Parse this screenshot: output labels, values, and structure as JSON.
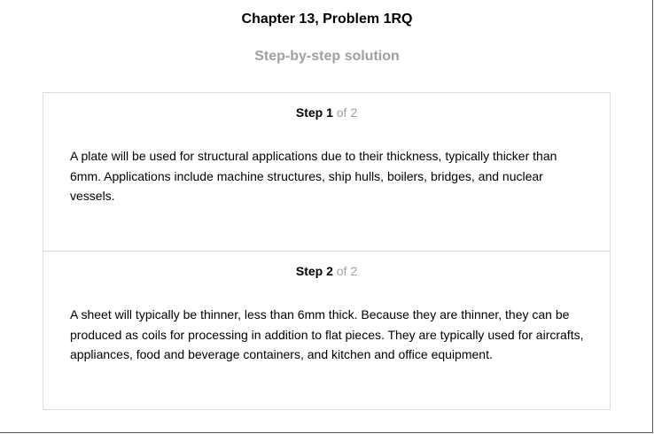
{
  "header": {
    "title": "Chapter 13, Problem 1RQ",
    "subtitle": "Step-by-step solution"
  },
  "steps": [
    {
      "label": "Step 1",
      "of": "of 2",
      "text": "A plate will be used for structural applications due to their thickness, typically thicker than 6mm. Applications include machine structures, ship hulls, boilers, bridges, and nuclear vessels."
    },
    {
      "label": "Step 2",
      "of": "of 2",
      "text": "A sheet will typically be thinner, less than 6mm thick. Because they are thinner, they can be produced as coils for processing in addition to flat pieces. They are typically used for aircrafts, appliances, food and beverage containers, and kitchen and office equipment."
    }
  ]
}
